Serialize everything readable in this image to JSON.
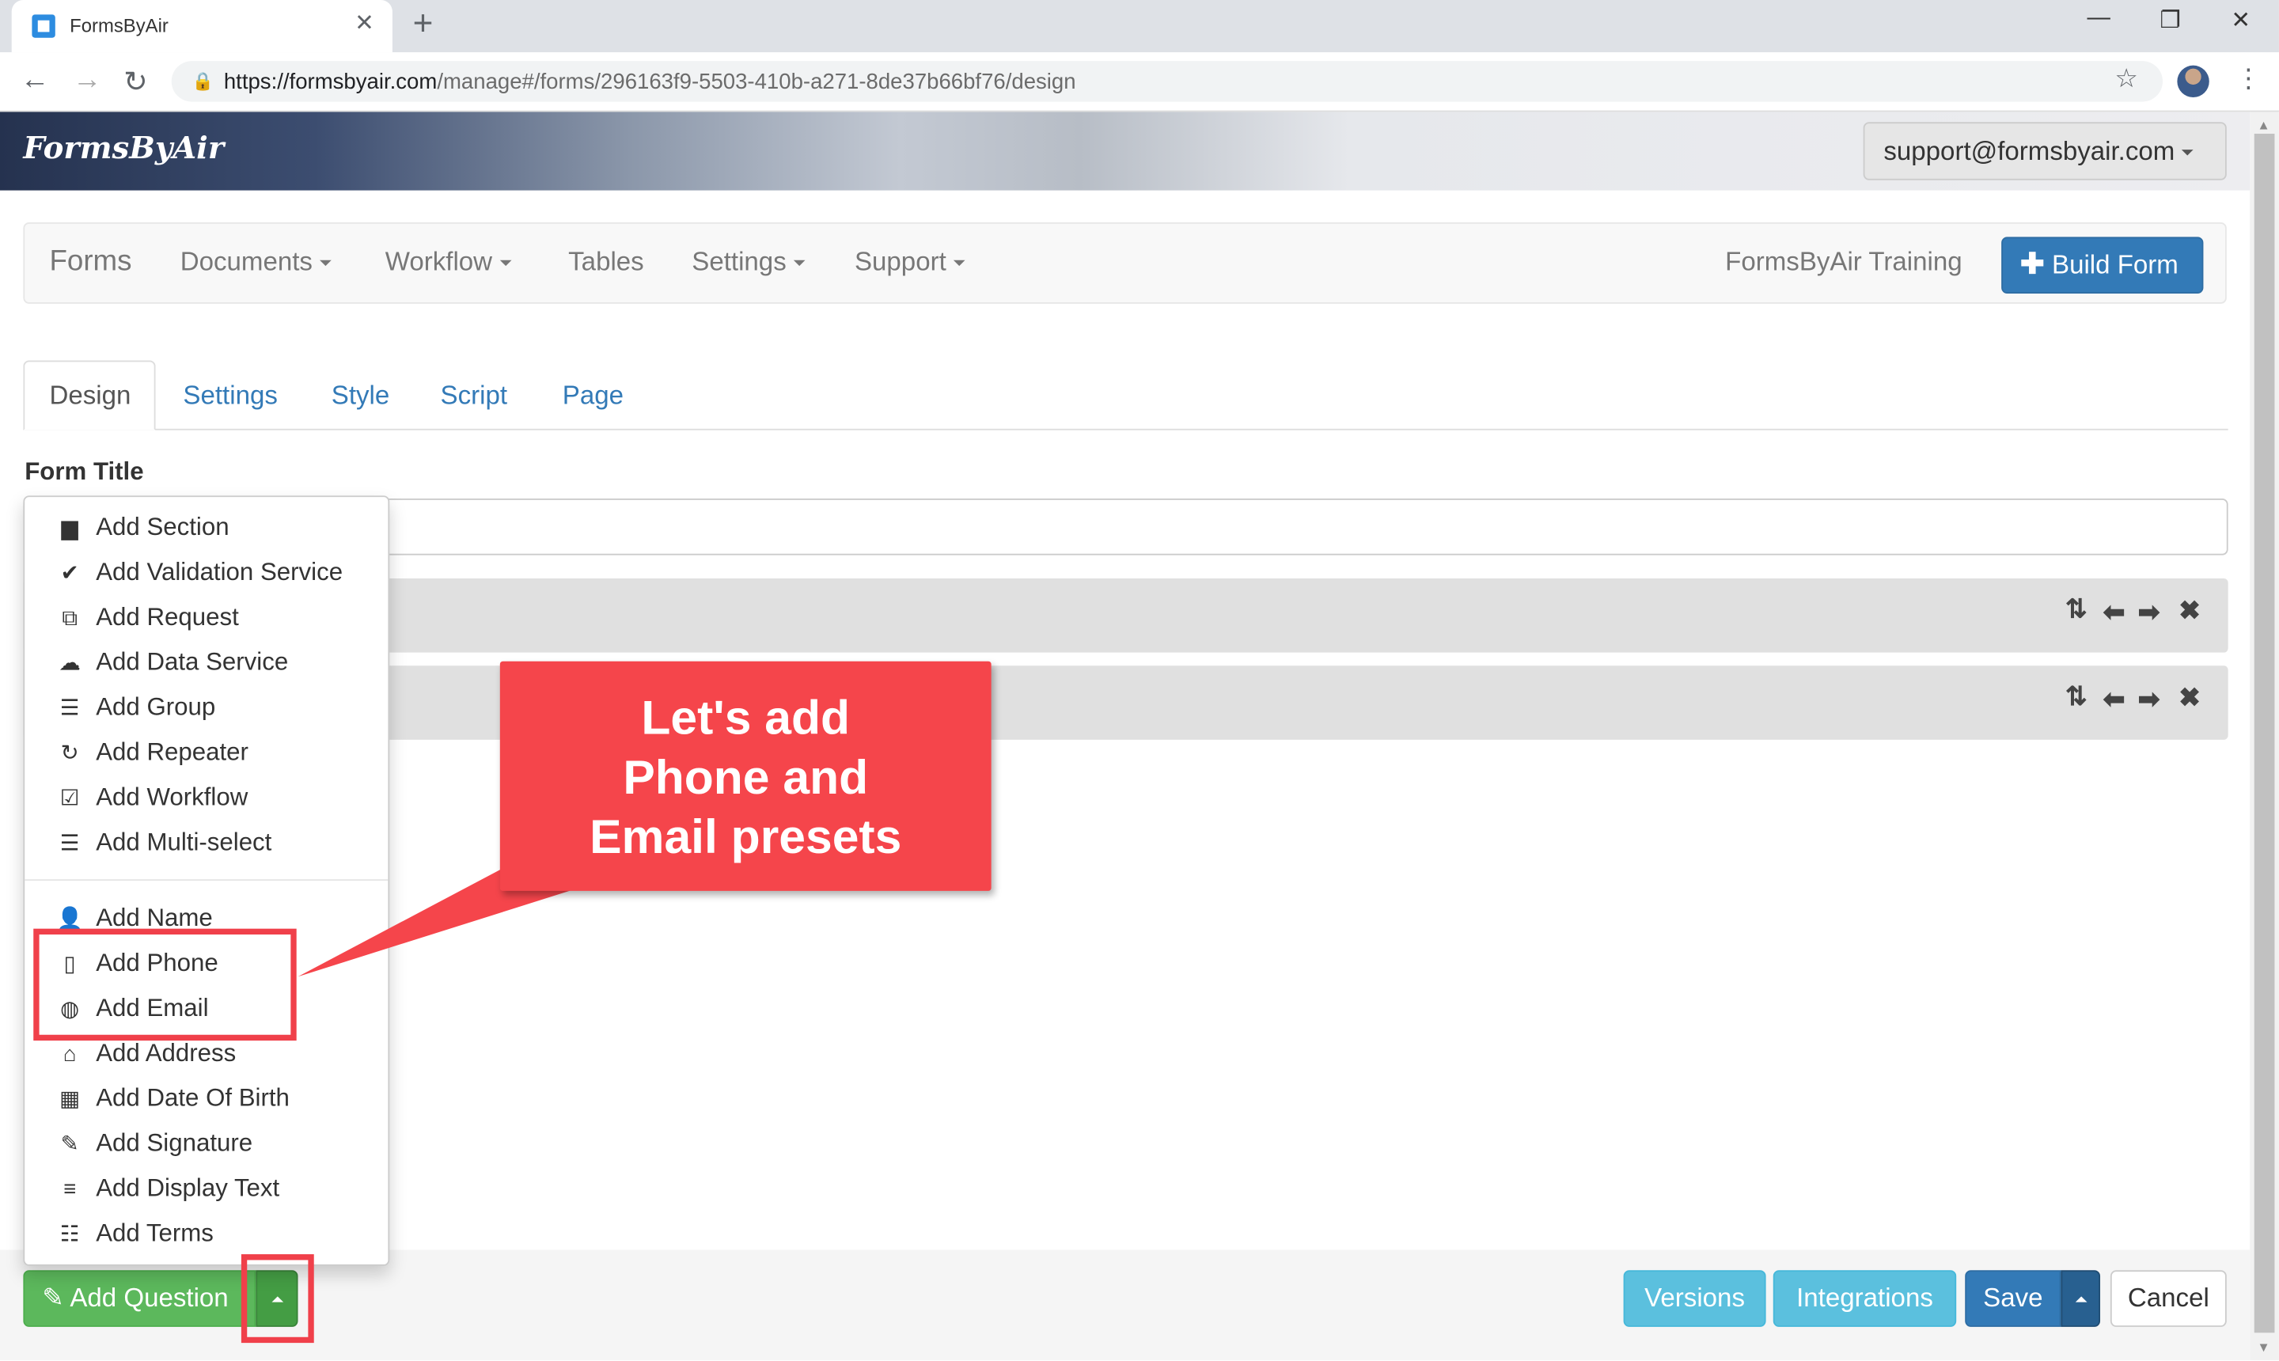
{
  "browser": {
    "tab_title": "FormsByAir",
    "url_host": "https://formsbyair.com",
    "url_path": "/manage#/forms/296163f9-5503-410b-a271-8de37b66bf76/design"
  },
  "header": {
    "logo": "FormsByAir",
    "account": "support@formsbyair.com"
  },
  "navbar": {
    "brand": "Forms",
    "items": [
      "Documents",
      "Workflow",
      "Tables",
      "Settings",
      "Support"
    ],
    "org": "FormsByAir Training",
    "build_button": "Build Form"
  },
  "tabs": [
    "Design",
    "Settings",
    "Style",
    "Script",
    "Page"
  ],
  "form": {
    "title_label": "Form Title",
    "title_value": ""
  },
  "menu": {
    "group1": [
      {
        "label": "Add Section",
        "icon": "file-icon"
      },
      {
        "label": "Add Validation Service",
        "icon": "check-circle-icon"
      },
      {
        "label": "Add Request",
        "icon": "external-link-icon"
      },
      {
        "label": "Add Data Service",
        "icon": "cloud-icon"
      },
      {
        "label": "Add Group",
        "icon": "list-alt-icon"
      },
      {
        "label": "Add Repeater",
        "icon": "refresh-icon"
      },
      {
        "label": "Add Workflow",
        "icon": "check-square-icon"
      },
      {
        "label": "Add Multi-select",
        "icon": "list-alt-icon"
      }
    ],
    "group2": [
      {
        "label": "Add Name",
        "icon": "user-icon"
      },
      {
        "label": "Add Phone",
        "icon": "phone-icon"
      },
      {
        "label": "Add Email",
        "icon": "globe-icon"
      },
      {
        "label": "Add Address",
        "icon": "home-icon"
      },
      {
        "label": "Add Date Of Birth",
        "icon": "calendar-icon"
      },
      {
        "label": "Add Signature",
        "icon": "edit-icon"
      },
      {
        "label": "Add Display Text",
        "icon": "align-justify-icon"
      },
      {
        "label": "Add Terms",
        "icon": "list-icon"
      }
    ]
  },
  "footer": {
    "add_question": "Add Question",
    "versions": "Versions",
    "integrations": "Integrations",
    "save": "Save",
    "cancel": "Cancel"
  },
  "annotation": {
    "callout_lines": [
      "Let's add",
      "Phone and",
      "Email presets"
    ],
    "color": "#f5454b"
  },
  "colors": {
    "primary": "#337ab7",
    "success": "#5cb85c",
    "info": "#5bc0de"
  }
}
